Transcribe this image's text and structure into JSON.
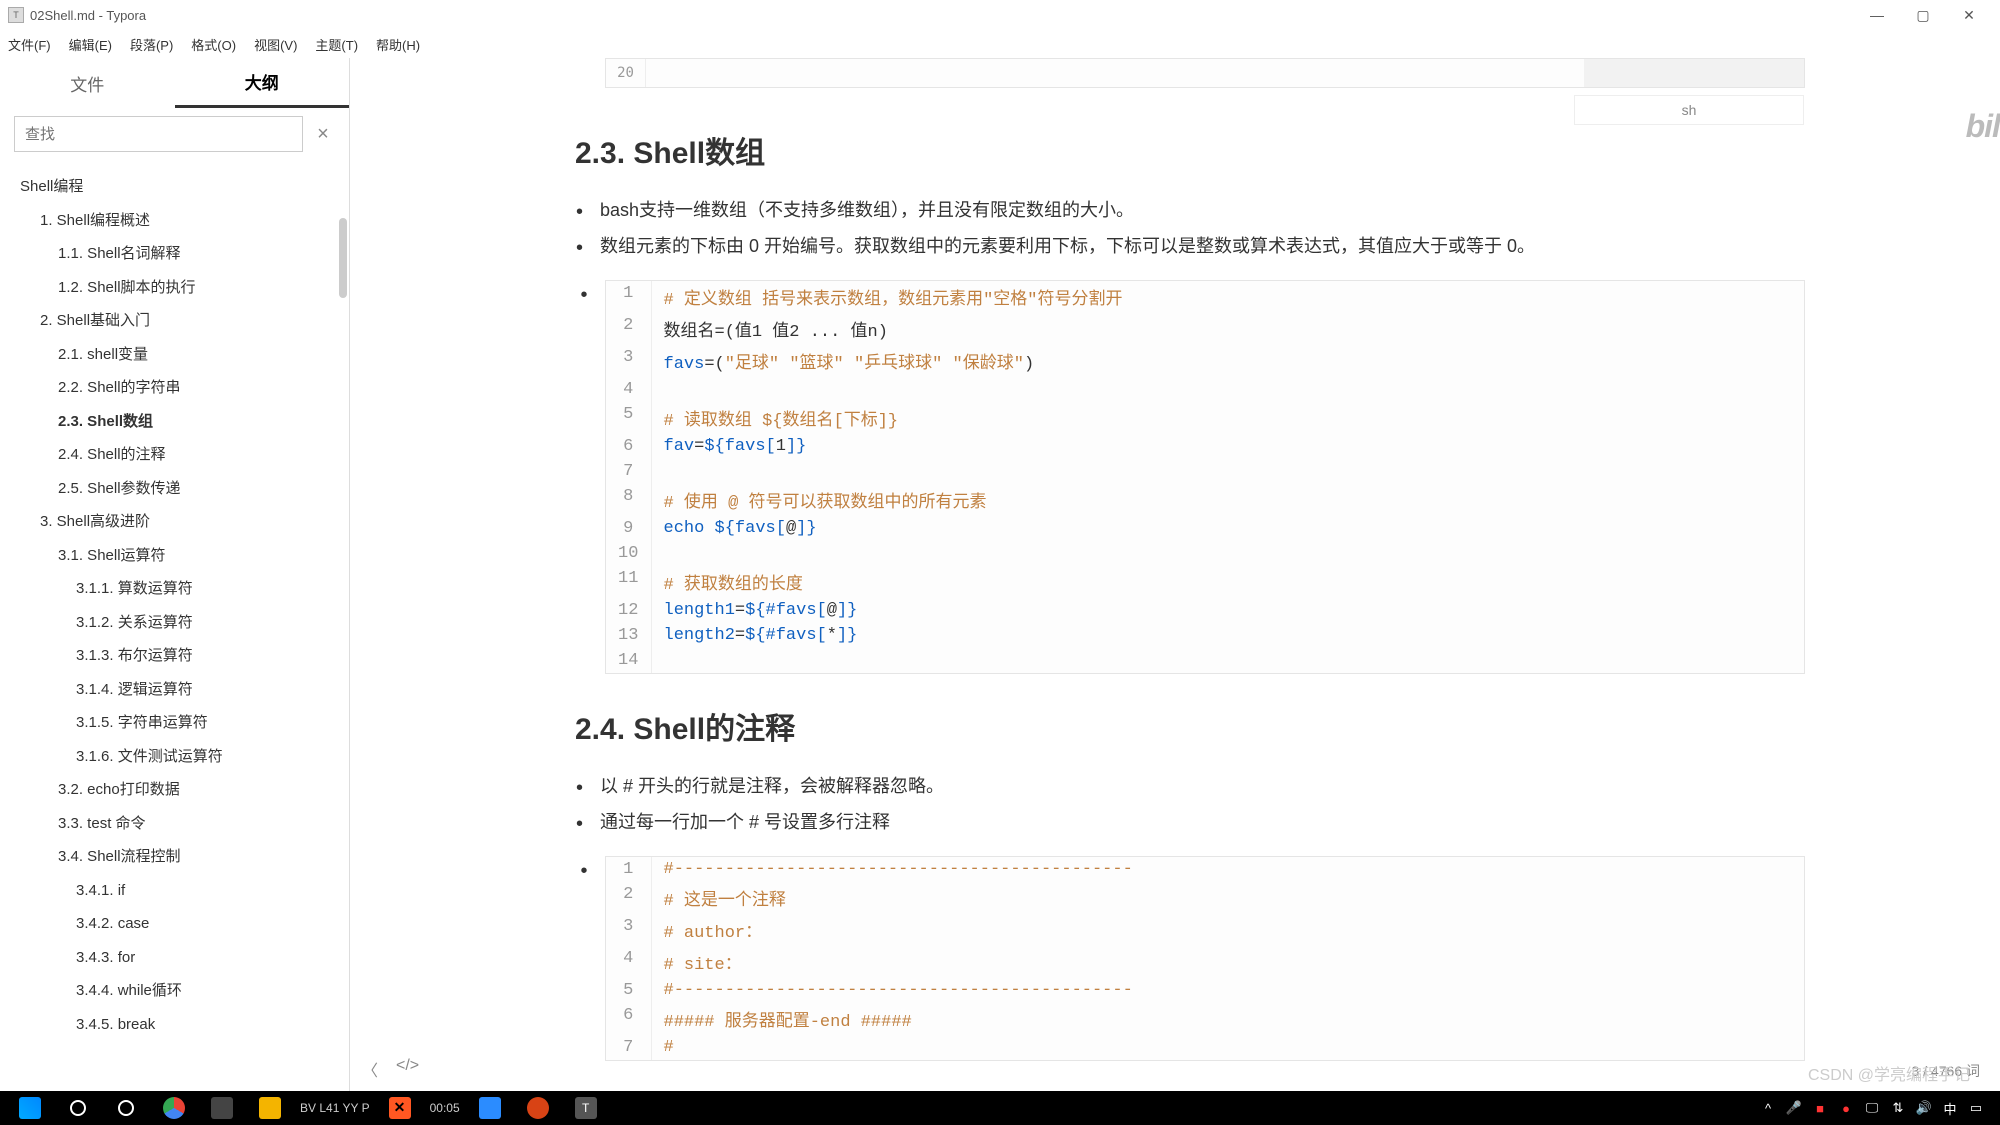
{
  "window": {
    "title": "02Shell.md - Typora",
    "icon_letter": "T"
  },
  "menu": {
    "file": "文件(F)",
    "edit": "编辑(E)",
    "para": "段落(P)",
    "format": "格式(O)",
    "view": "视图(V)",
    "theme": "主题(T)",
    "help": "帮助(H)"
  },
  "sidebar": {
    "tab_file": "文件",
    "tab_outline": "大纲",
    "search_placeholder": "查找",
    "outline": [
      {
        "l": 1,
        "t": "Shell编程"
      },
      {
        "l": 2,
        "t": "1. Shell编程概述"
      },
      {
        "l": 3,
        "t": "1.1. Shell名词解释"
      },
      {
        "l": 3,
        "t": "1.2. Shell脚本的执行"
      },
      {
        "l": 2,
        "t": "2. Shell基础入门"
      },
      {
        "l": 3,
        "t": "2.1. shell变量"
      },
      {
        "l": 3,
        "t": "2.2. Shell的字符串"
      },
      {
        "l": 3,
        "t": "2.3. Shell数组",
        "active": true
      },
      {
        "l": 3,
        "t": "2.4. Shell的注释"
      },
      {
        "l": 3,
        "t": "2.5. Shell参数传递"
      },
      {
        "l": 2,
        "t": "3. Shell高级进阶"
      },
      {
        "l": 3,
        "t": "3.1. Shell运算符"
      },
      {
        "l": 4,
        "t": "3.1.1. 算数运算符"
      },
      {
        "l": 4,
        "t": "3.1.2. 关系运算符"
      },
      {
        "l": 4,
        "t": "3.1.3. 布尔运算符"
      },
      {
        "l": 4,
        "t": "3.1.4. 逻辑运算符"
      },
      {
        "l": 4,
        "t": "3.1.5. 字符串运算符"
      },
      {
        "l": 4,
        "t": "3.1.6. 文件测试运算符"
      },
      {
        "l": 3,
        "t": "3.2. echo打印数据"
      },
      {
        "l": 3,
        "t": "3.3. test 命令"
      },
      {
        "l": 3,
        "t": "3.4. Shell流程控制"
      },
      {
        "l": 4,
        "t": "3.4.1. if"
      },
      {
        "l": 4,
        "t": "3.4.2. case"
      },
      {
        "l": 4,
        "t": "3.4.3. for"
      },
      {
        "l": 4,
        "t": "3.4.4. while循环"
      },
      {
        "l": 4,
        "t": "3.4.5. break"
      }
    ]
  },
  "content": {
    "top_ln": "20",
    "top_lang": "sh",
    "brand": "bilibili",
    "h23": "2.3. Shell数组",
    "b23a": "bash支持一维数组（不支持多维数组），并且没有限定数组的大小。",
    "b23b": "数组元素的下标由 0 开始编号。获取数组中的元素要利用下标，下标可以是整数或算术表达式，其值应大于或等于 0。",
    "code1": [
      {
        "n": "1",
        "html": "<span class='c-comm'># 定义数组 括号来表示数组，数组元素用\"空格\"符号分割开</span>"
      },
      {
        "n": "2",
        "html": "数组名=(值1 值2 ... 值n)"
      },
      {
        "n": "3",
        "html": "<span class='c-var'>favs</span>=(<span class='c-str'>\"足球\"</span> <span class='c-str'>\"篮球\"</span> <span class='c-str'>\"乒乓球球\"</span> <span class='c-str'>\"保龄球\"</span>)"
      },
      {
        "n": "4",
        "html": ""
      },
      {
        "n": "5",
        "html": "<span class='c-comm'># 读取数组 ${数组名[下标]}</span>"
      },
      {
        "n": "6",
        "html": "<span class='c-var'>fav</span>=<span class='c-kw'>${favs[</span>1<span class='c-kw'>]}</span>"
      },
      {
        "n": "7",
        "html": ""
      },
      {
        "n": "8",
        "html": "<span class='c-comm'># 使用 @ 符号可以获取数组中的所有元素</span>"
      },
      {
        "n": "9",
        "html": "<span class='c-kw'>echo</span> <span class='c-kw'>${favs[</span>@<span class='c-kw'>]}</span>"
      },
      {
        "n": "10",
        "html": ""
      },
      {
        "n": "11",
        "html": "<span class='c-comm'># 获取数组的长度</span>"
      },
      {
        "n": "12",
        "html": "<span class='c-var'>length1</span>=<span class='c-kw'>${#favs[</span>@<span class='c-kw'>]}</span>"
      },
      {
        "n": "13",
        "html": "<span class='c-var'>length2</span>=<span class='c-kw'>${#favs[</span>*<span class='c-kw'>]}</span>"
      },
      {
        "n": "14",
        "html": ""
      }
    ],
    "h24": "2.4. Shell的注释",
    "b24a": "以 # 开头的行就是注释，会被解释器忽略。",
    "b24b": "通过每一行加一个 # 号设置多行注释",
    "code2": [
      {
        "n": "1",
        "html": "<span class='c-comm'>#---------------------------------------------</span>"
      },
      {
        "n": "2",
        "html": "<span class='c-comm'># 这是一个注释</span>"
      },
      {
        "n": "3",
        "html": "<span class='c-comm'># author：</span>"
      },
      {
        "n": "4",
        "html": "<span class='c-comm'># site：</span>"
      },
      {
        "n": "5",
        "html": "<span class='c-comm'>#---------------------------------------------</span>"
      },
      {
        "n": "6",
        "html": "<span class='c-comm'>##### 服务器配置-end #####</span>"
      },
      {
        "n": "7",
        "html": "<span class='c-comm'>#</span>"
      }
    ]
  },
  "status": {
    "back": "〈",
    "code": "</>",
    "words": "3 / 4766 词"
  },
  "watermark": "CSDN @学亮编程手记",
  "taskbar": {
    "time": "00:05",
    "video_id": "BV  L41   YY P"
  }
}
